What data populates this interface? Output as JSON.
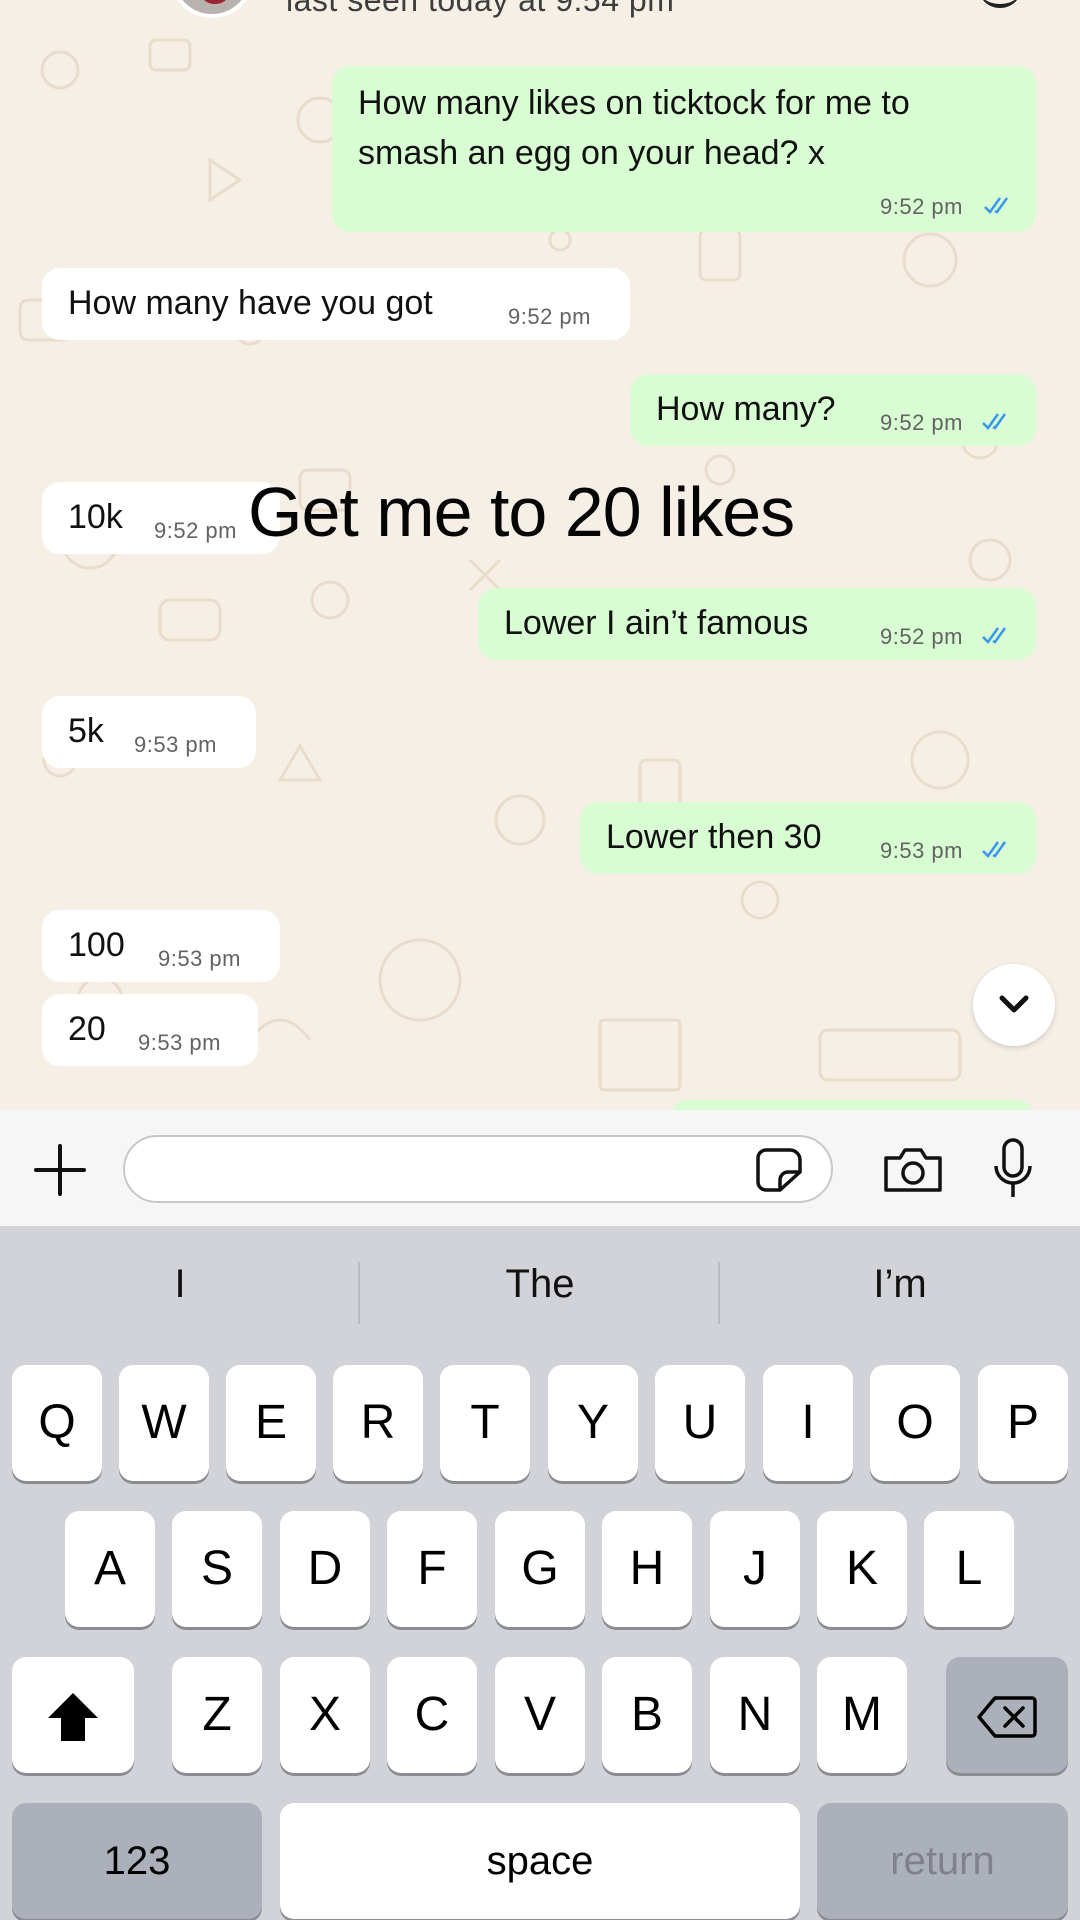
{
  "header": {
    "status": "last seen today at 9:54 pm"
  },
  "messages": [
    {
      "dir": "out",
      "lines": [
        "How many likes on ticktock for me to",
        "smash an egg on your head? x"
      ],
      "time": "9:52 pm",
      "ticks": "read"
    },
    {
      "dir": "in",
      "text": "How many have you got",
      "time": "9:52 pm"
    },
    {
      "dir": "out",
      "text": "How many?",
      "time": "9:52 pm",
      "ticks": "read"
    },
    {
      "dir": "in",
      "text": "10k",
      "time": "9:52 pm"
    },
    {
      "dir": "out",
      "text": "Lower I ain’t famous",
      "time": "9:52 pm",
      "ticks": "read"
    },
    {
      "dir": "in",
      "text": "5k",
      "time": "9:53 pm"
    },
    {
      "dir": "out",
      "text": "Lower then 30",
      "time": "9:53 pm",
      "ticks": "read"
    },
    {
      "dir": "in",
      "text": "100",
      "time": "9:53 pm"
    },
    {
      "dir": "in",
      "text": "20",
      "time": "9:53 pm"
    }
  ],
  "overlay_caption": "Get me to 20 likes",
  "input": {
    "placeholder": ""
  },
  "icons": {
    "attach": "plus-icon",
    "sticker": "sticker-icon",
    "camera": "camera-icon",
    "mic": "microphone-icon",
    "scroll_down": "chevron-down-icon",
    "read_receipt": "double-check-icon"
  },
  "colors": {
    "outgoing_bubble": "#d8fdd2",
    "incoming_bubble": "#ffffff",
    "tick_blue": "#3797ef",
    "chat_bg": "#f5efe6"
  },
  "keyboard": {
    "suggestions": [
      "I",
      "The",
      "I’m"
    ],
    "row1": [
      "Q",
      "W",
      "E",
      "R",
      "T",
      "Y",
      "U",
      "I",
      "O",
      "P"
    ],
    "row2": [
      "A",
      "S",
      "D",
      "F",
      "G",
      "H",
      "J",
      "K",
      "L"
    ],
    "row3": [
      "Z",
      "X",
      "C",
      "V",
      "B",
      "N",
      "M"
    ],
    "numbers_key": "123",
    "space_key": "space",
    "return_key": "return"
  }
}
